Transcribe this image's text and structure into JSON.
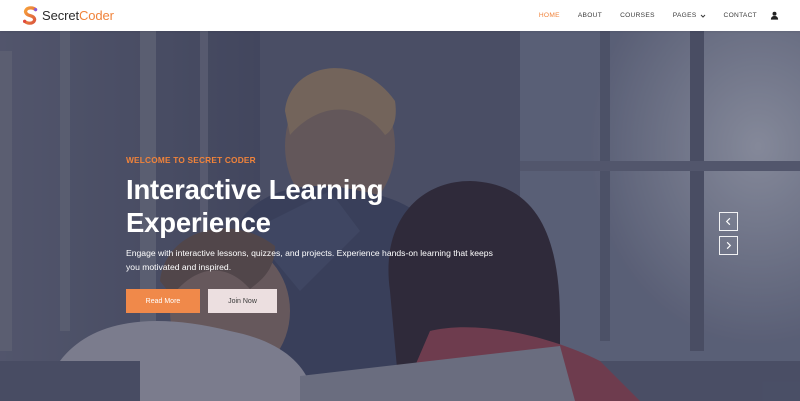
{
  "brand": {
    "name_part1": "Secret",
    "name_part2": "Coder",
    "accent_color": "#f0833b"
  },
  "nav": {
    "items": [
      {
        "label": "HOME",
        "active": true
      },
      {
        "label": "ABOUT",
        "active": false
      },
      {
        "label": "COURSES",
        "active": false
      },
      {
        "label": "PAGES",
        "active": false,
        "dropdown": true
      },
      {
        "label": "CONTACT",
        "active": false
      }
    ],
    "user_icon": "user-icon"
  },
  "hero": {
    "eyebrow": "WELCOME TO SECRET CODER",
    "headline_line1": "Interactive Learning",
    "headline_line2": "Experience",
    "description": "Engage with interactive lessons, quizzes, and projects. Experience hands-on learning that keeps you motivated and inspired.",
    "primary_button": "Read More",
    "secondary_button": "Join Now",
    "prev_icon": "chevron-left-icon",
    "next_icon": "chevron-right-icon"
  },
  "colors": {
    "primary_button": "#f0894a",
    "secondary_button": "#ecdfe0",
    "overlay": "#202640"
  }
}
